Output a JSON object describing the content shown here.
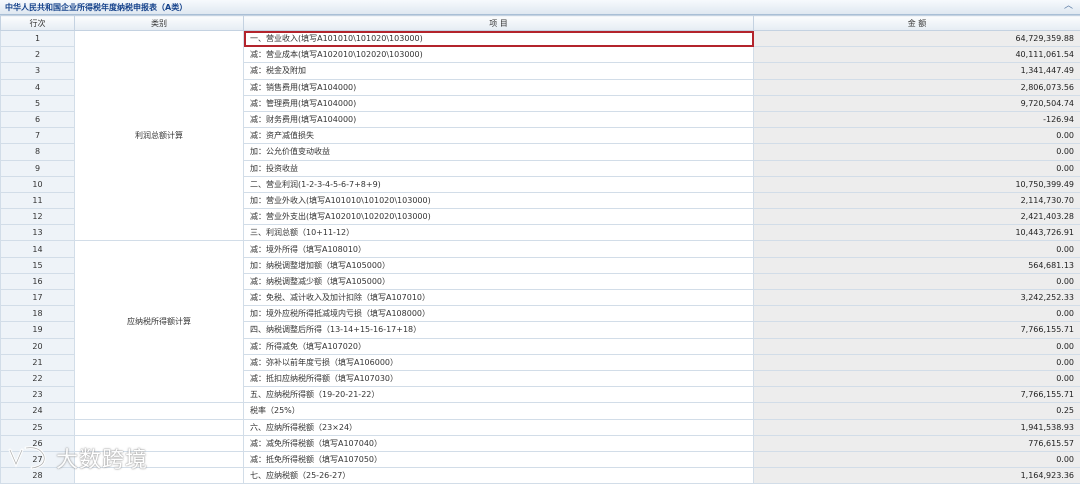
{
  "header": {
    "title": "中华人民共和国企业所得税年度纳税申报表（A类）",
    "collapse_icon": "chevron-up-icon"
  },
  "columns": {
    "row_no": "行次",
    "category": "类别",
    "item": "项 目",
    "amount": "金 额"
  },
  "categories": {
    "profit": "利润总额计算",
    "taxable": "应纳税所得额计算"
  },
  "rows": [
    {
      "no": "1",
      "item": "一、营业收入(填写A101010\\101020\\103000)",
      "amount": "64,729,359.88"
    },
    {
      "no": "2",
      "item": "减：营业成本(填写A102010\\102020\\103000)",
      "amount": "40,111,061.54"
    },
    {
      "no": "3",
      "item": "减：税金及附加",
      "amount": "1,341,447.49"
    },
    {
      "no": "4",
      "item": "减：销售费用(填写A104000)",
      "amount": "2,806,073.56"
    },
    {
      "no": "5",
      "item": "减：管理费用(填写A104000)",
      "amount": "9,720,504.74"
    },
    {
      "no": "6",
      "item": "减：财务费用(填写A104000)",
      "amount": "-126.94"
    },
    {
      "no": "7",
      "item": "减：资产减值损失",
      "amount": "0.00"
    },
    {
      "no": "8",
      "item": "加：公允价值变动收益",
      "amount": "0.00"
    },
    {
      "no": "9",
      "item": "加：投资收益",
      "amount": "0.00"
    },
    {
      "no": "10",
      "item": "二、营业利润(1-2-3-4-5-6-7+8+9)",
      "amount": "10,750,399.49"
    },
    {
      "no": "11",
      "item": "加：营业外收入(填写A101010\\101020\\103000)",
      "amount": "2,114,730.70"
    },
    {
      "no": "12",
      "item": "减：营业外支出(填写A102010\\102020\\103000)",
      "amount": "2,421,403.28"
    },
    {
      "no": "13",
      "item": "三、利润总额（10+11-12）",
      "amount": "10,443,726.91"
    },
    {
      "no": "14",
      "item": "减：境外所得（填写A108010）",
      "amount": "0.00"
    },
    {
      "no": "15",
      "item": "加：纳税调整增加额（填写A105000）",
      "amount": "564,681.13"
    },
    {
      "no": "16",
      "item": "减：纳税调整减少额（填写A105000）",
      "amount": "0.00"
    },
    {
      "no": "17",
      "item": "减：免税、减计收入及加计扣除（填写A107010）",
      "amount": "3,242,252.33"
    },
    {
      "no": "18",
      "item": "加：境外应税所得抵减境内亏损（填写A108000）",
      "amount": "0.00"
    },
    {
      "no": "19",
      "item": "四、纳税调整后所得（13-14+15-16-17+18）",
      "amount": "7,766,155.71"
    },
    {
      "no": "20",
      "item": "减：所得减免（填写A107020）",
      "amount": "0.00"
    },
    {
      "no": "21",
      "item": "减：弥补以前年度亏损（填写A106000）",
      "amount": "0.00"
    },
    {
      "no": "22",
      "item": "减：抵扣应纳税所得额（填写A107030）",
      "amount": "0.00"
    },
    {
      "no": "23",
      "item": "五、应纳税所得额（19-20-21-22）",
      "amount": "7,766,155.71"
    },
    {
      "no": "24",
      "item": "税率（25%）",
      "amount": "0.25"
    },
    {
      "no": "25",
      "item": "六、应纳所得税额（23×24）",
      "amount": "1,941,538.93"
    },
    {
      "no": "26",
      "item": "减：减免所得税额（填写A107040）",
      "amount": "776,615.57"
    },
    {
      "no": "27",
      "item": "减：抵免所得税额（填写A107050）",
      "amount": "0.00"
    },
    {
      "no": "28",
      "item": "七、应纳税额（25-26-27）",
      "amount": "1,164,923.36"
    }
  ],
  "watermark": {
    "text": "大数跨境"
  },
  "colors": {
    "highlight_border": "#b3242c",
    "header_text": "#15428b",
    "amount_cell_bg": "#ededed"
  }
}
